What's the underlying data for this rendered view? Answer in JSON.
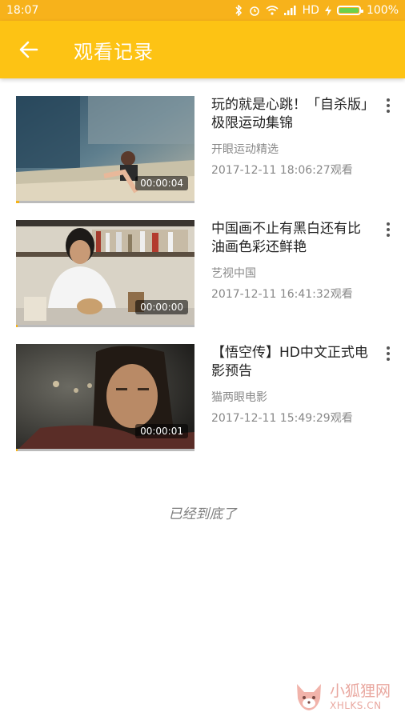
{
  "status_bar": {
    "time": "18:07",
    "network": "HD",
    "battery": "100%"
  },
  "header": {
    "title": "观看记录"
  },
  "history": [
    {
      "title": "玩的就是心跳！「自杀版」极限运动集锦",
      "channel": "开眼运动精选",
      "watched": "2017-12-11 18:06:27观看",
      "duration": "00:00:04",
      "progress": 0.02
    },
    {
      "title": "中国画不止有黑白还有比油画色彩还鲜艳",
      "channel": "艺视中国",
      "watched": "2017-12-11 16:41:32观看",
      "duration": "00:00:00",
      "progress": 0.01
    },
    {
      "title": "【悟空传】HD中文正式电影预告",
      "channel": "猫两眼电影",
      "watched": "2017-12-11 15:49:29观看",
      "duration": "00:00:01",
      "progress": 0.01
    }
  ],
  "footer": {
    "end_text": "已经到底了"
  },
  "watermark": {
    "cn": "小狐狸网",
    "en": "XHLKS.CN"
  },
  "colors": {
    "status_bar": "#f7b21b",
    "app_bar": "#fdc314",
    "progress": "#f6b317"
  }
}
